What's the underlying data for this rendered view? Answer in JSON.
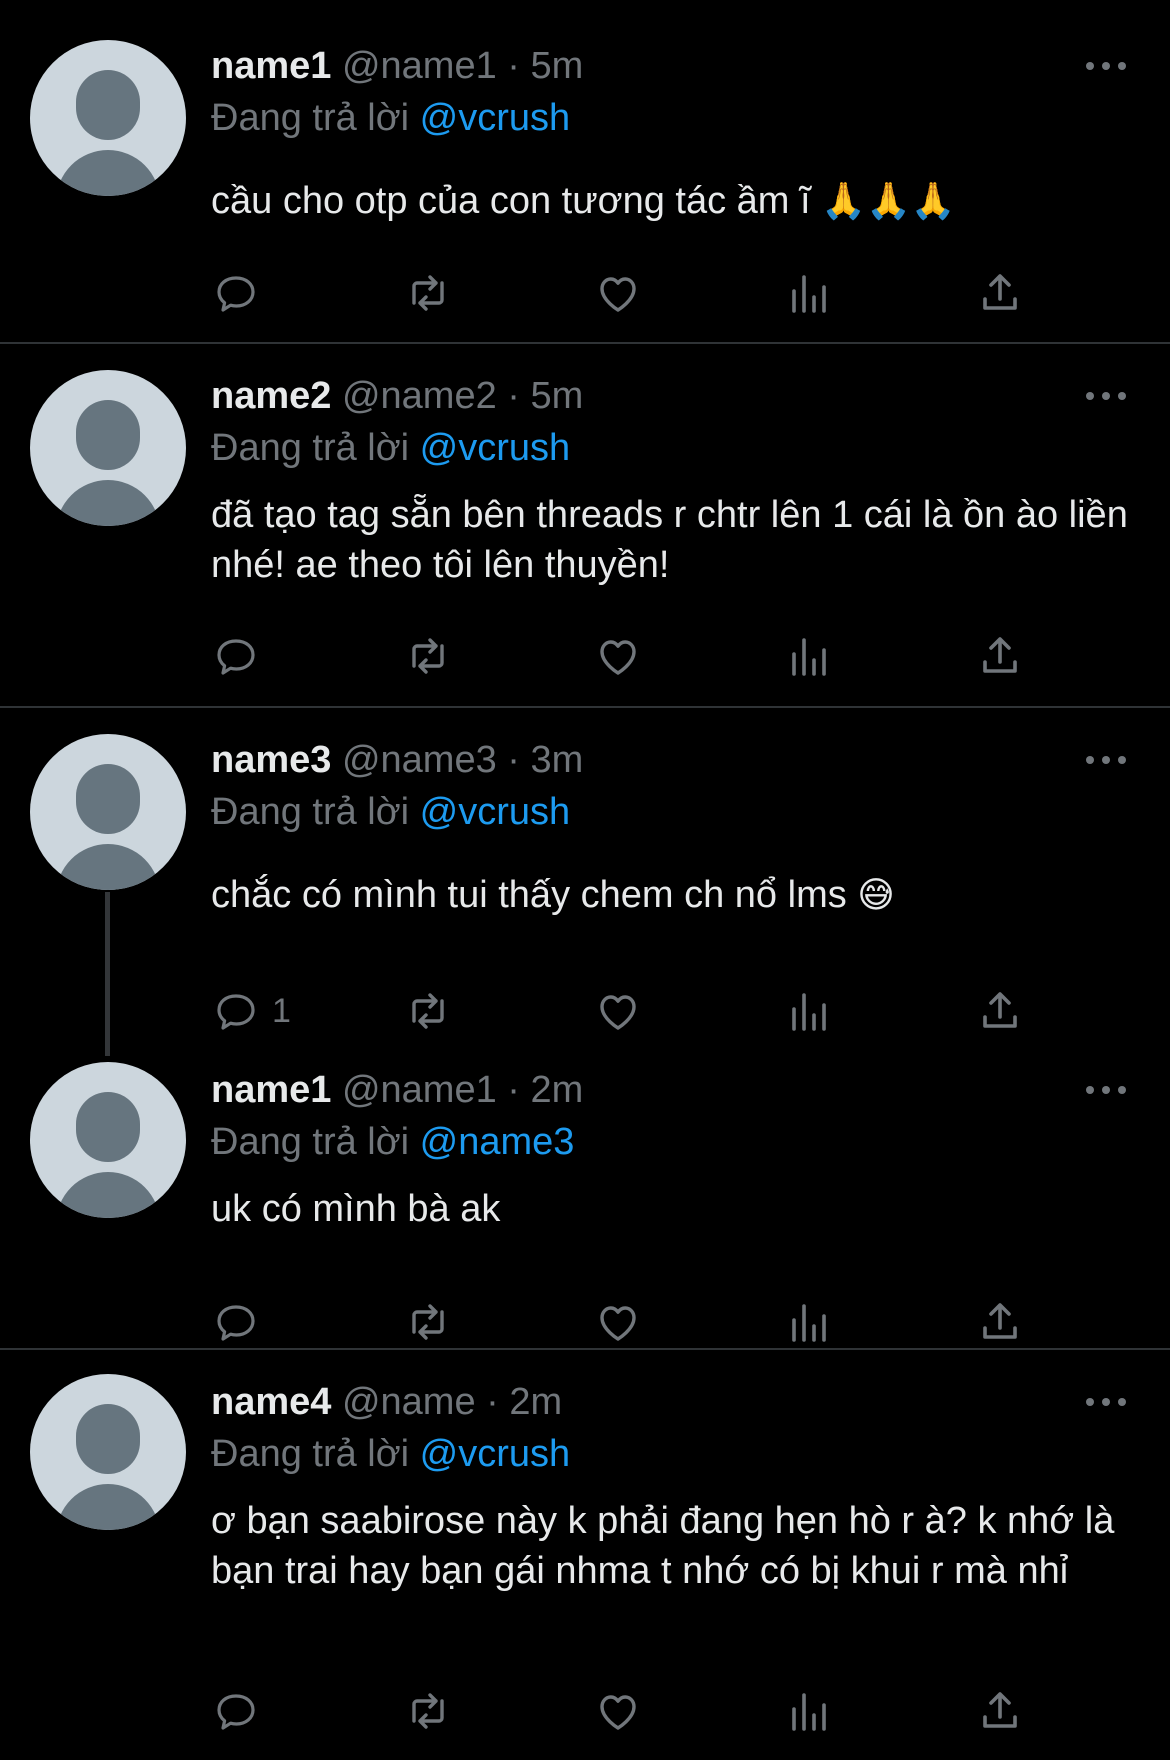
{
  "tweets": [
    {
      "name": "name1",
      "handle": "@name1",
      "time": "5m",
      "reply_prefix": "Đang trả lời",
      "reply_to": "@vcrush",
      "text": "cầu cho otp của con tương tác ầm ĩ",
      "emoji": "🙏🙏🙏",
      "reply_count": ""
    },
    {
      "name": "name2",
      "handle": "@name2",
      "time": "5m",
      "reply_prefix": "Đang trả lời",
      "reply_to": "@vcrush",
      "text": "đã tạo tag sẵn bên threads r chtr lên 1 cái là ồn ào liền nhé! ae theo tôi lên thuyền!",
      "emoji": "",
      "reply_count": ""
    },
    {
      "name": "name3",
      "handle": "@name3",
      "time": "3m",
      "reply_prefix": "Đang trả lời",
      "reply_to": "@vcrush",
      "text": "chắc có mình tui thấy chem ch nổ lms",
      "emoji": "😅",
      "reply_count": "1"
    },
    {
      "name": "name1",
      "handle": "@name1",
      "time": "2m",
      "reply_prefix": "Đang trả lời",
      "reply_to": "@name3",
      "text": "uk có mình bà ak",
      "emoji": "",
      "reply_count": ""
    },
    {
      "name": "name4",
      "handle": "@name",
      "time": "2m",
      "reply_prefix": "Đang trả lời",
      "reply_to": "@vcrush",
      "text": "ơ bạn saabirose này k phải đang hẹn hò r à? k nhớ là bạn trai hay bạn gái nhma t nhớ có bị khui r mà nhỉ",
      "emoji": "",
      "reply_count": ""
    }
  ],
  "meta_separator": "·",
  "icons": [
    "reply-icon",
    "retweet-icon",
    "like-icon",
    "views-icon",
    "share-icon",
    "more-icon",
    "avatar-default-icon"
  ]
}
